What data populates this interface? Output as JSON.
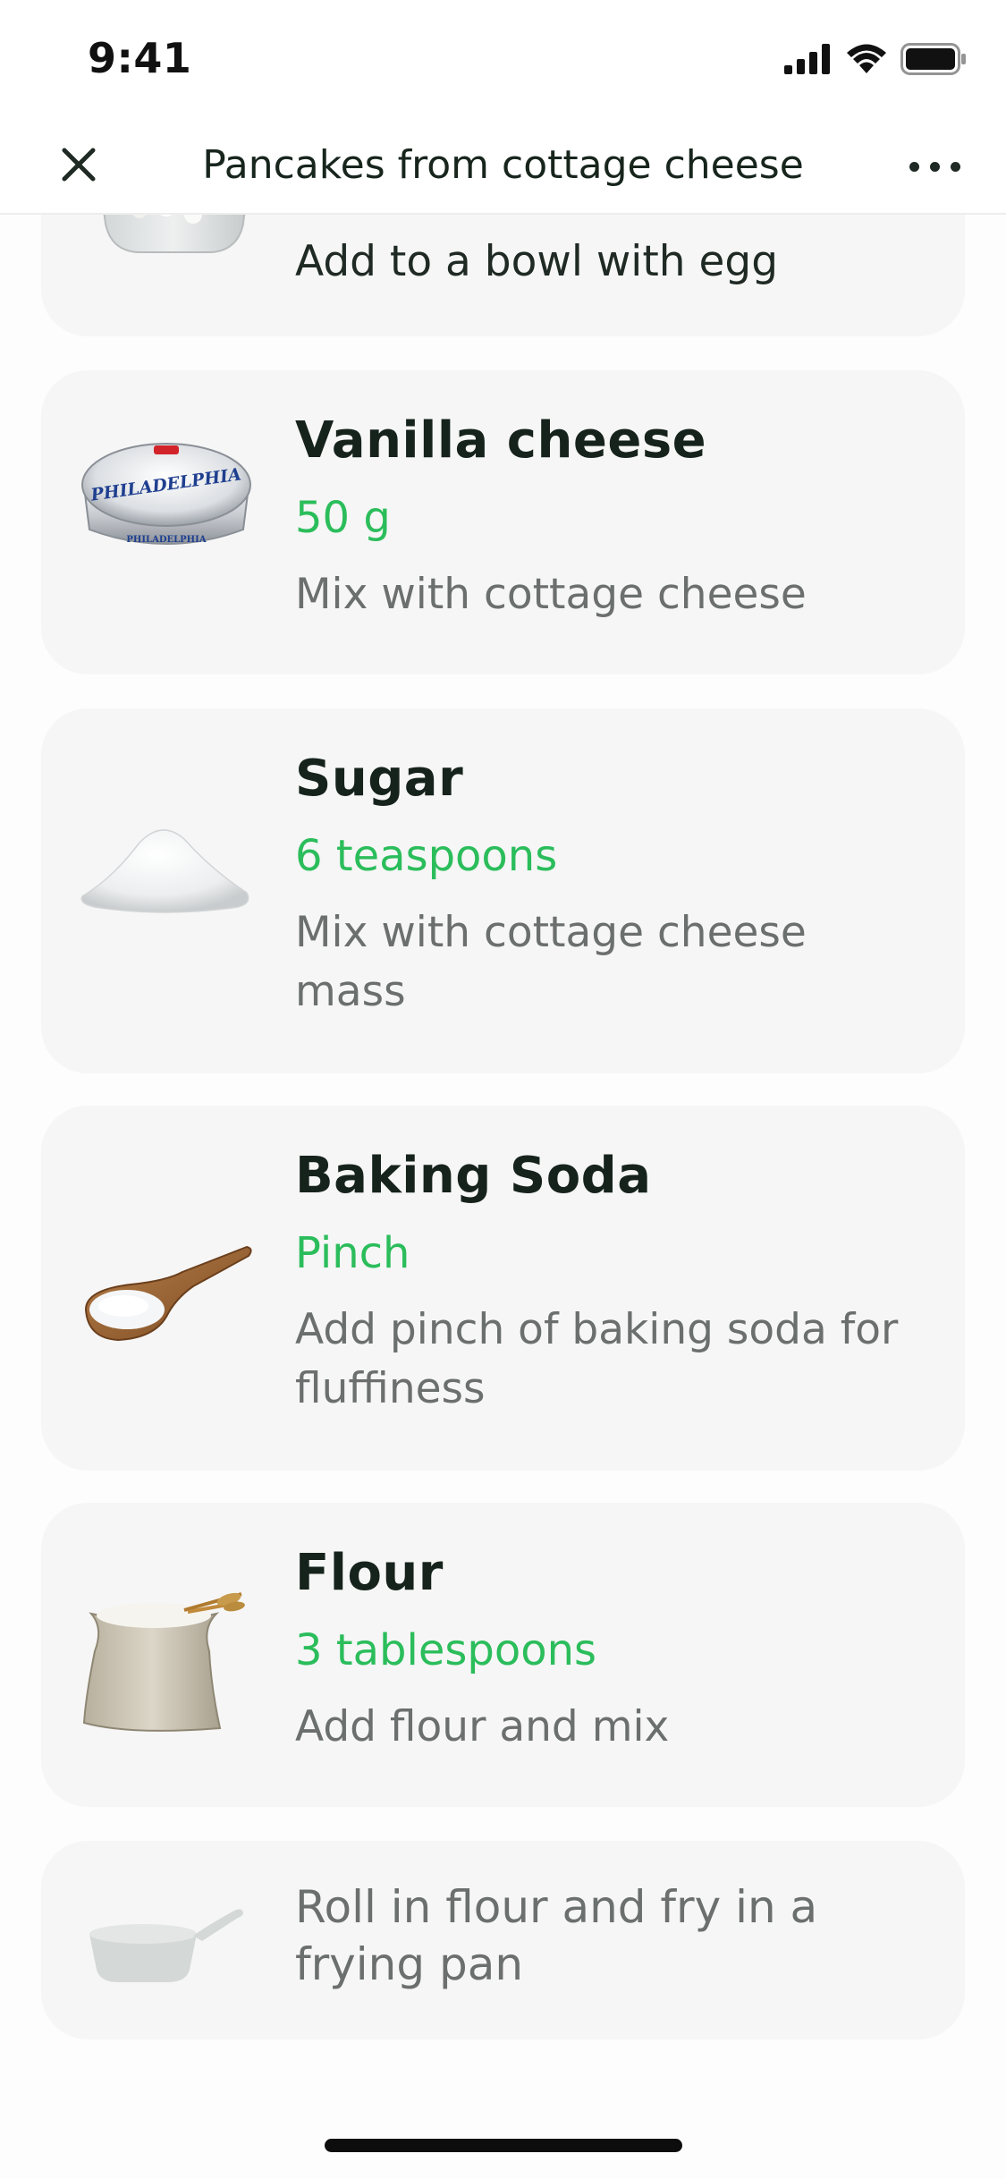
{
  "status_bar": {
    "time": "9:41"
  },
  "nav": {
    "title": "Pancakes from cottage cheese",
    "close_icon": "close-icon",
    "more_icon": "more-horizontal-icon"
  },
  "steps": [
    {
      "image": "cottage-cheese-bowl-image",
      "description": "Add to a bowl with egg"
    },
    {
      "image": "cream-cheese-tub-image",
      "image_label": "PHILADELPHIA",
      "name": "Vanilla cheese",
      "quantity": "50 g",
      "description": "Mix with cottage cheese"
    },
    {
      "image": "sugar-pile-image",
      "name": "Sugar",
      "quantity": "6 teaspoons",
      "description": "Mix with cottage cheese mass"
    },
    {
      "image": "baking-soda-spoon-image",
      "name": "Baking Soda",
      "quantity": "Pinch",
      "description": "Add pinch of baking soda for fluffiness"
    },
    {
      "image": "flour-sack-image",
      "name": "Flour",
      "quantity": "3 tablespoons",
      "description": "Add flour and mix"
    },
    {
      "image": "frying-pan-icon",
      "description": "Roll in flour and fry in a frying pan"
    }
  ],
  "colors": {
    "quantity_green": "#2bbd5b",
    "card_background": "#f6f6f6",
    "title_text": "#16231c",
    "description_text": "#6b6f6d"
  }
}
